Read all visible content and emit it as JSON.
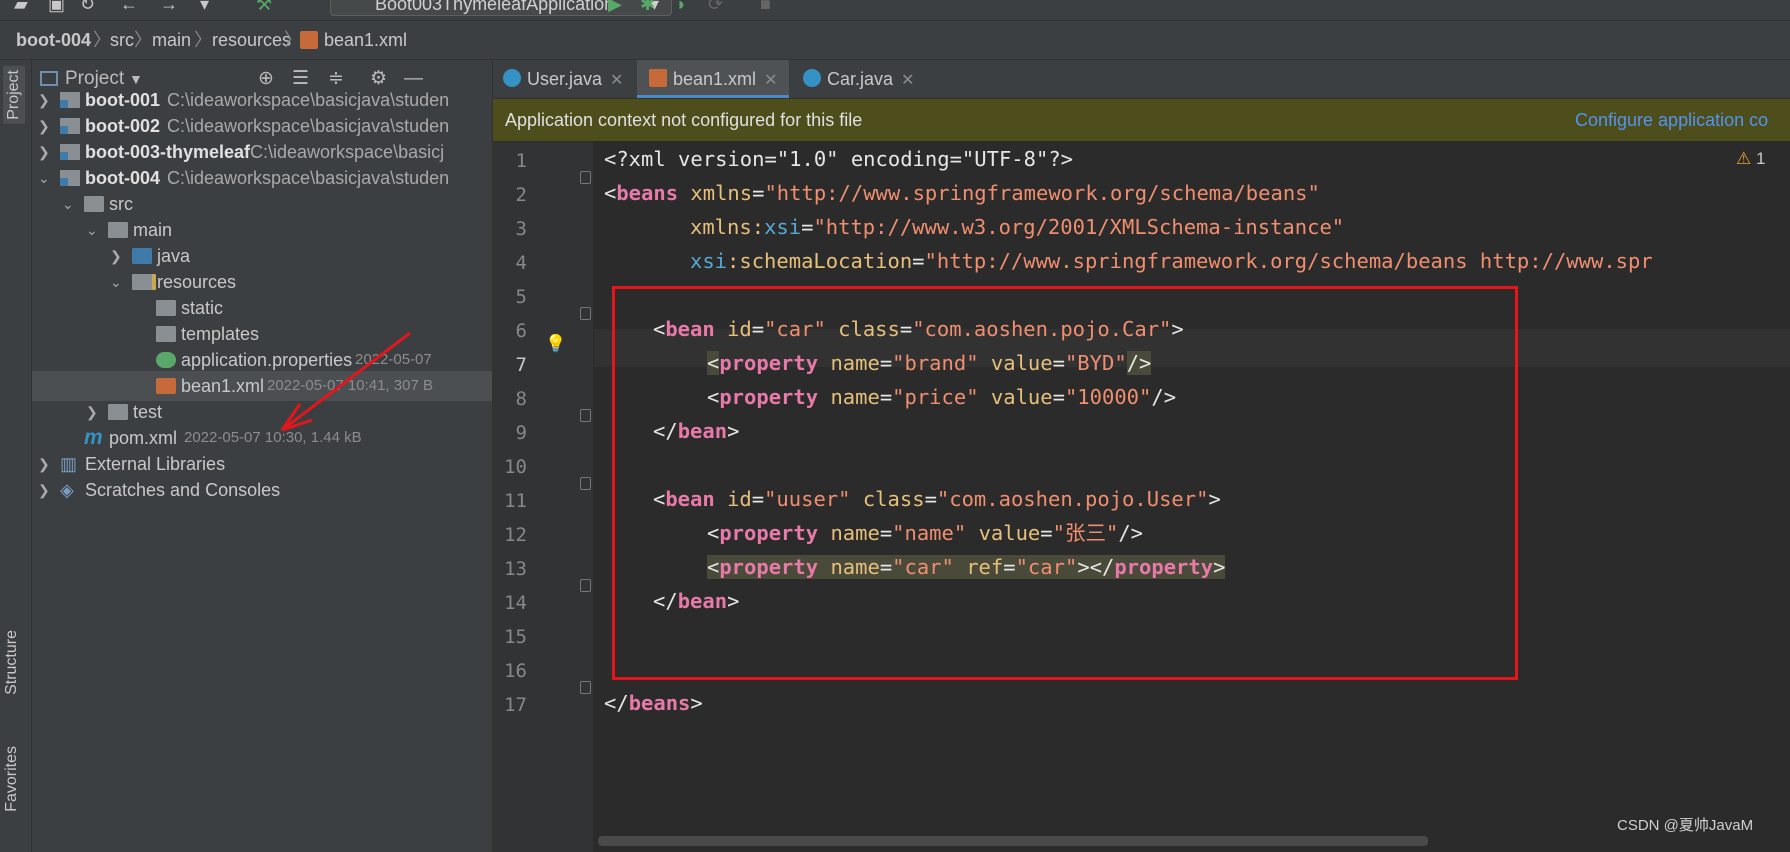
{
  "toolbar": {
    "run_config_label": "Boot003ThymeleafApplication"
  },
  "breadcrumb": {
    "items": [
      "boot-004",
      "src",
      "main",
      "resources",
      "bean1.xml"
    ]
  },
  "side_tabs": {
    "project": "Project",
    "structure": "Structure",
    "favorites": "Favorites"
  },
  "project_panel": {
    "title": "Project",
    "tree": [
      {
        "label": "boot-001",
        "path": "C:\\ideaworkspace\\basicjava\\studen"
      },
      {
        "label": "boot-002",
        "path": "C:\\ideaworkspace\\basicjava\\studen"
      },
      {
        "label": "boot-003-thymeleaf",
        "path": "C:\\ideaworkspace\\basicj"
      },
      {
        "label": "boot-004",
        "path": "C:\\ideaworkspace\\basicjava\\studen"
      },
      {
        "label": "src"
      },
      {
        "label": "main"
      },
      {
        "label": "java"
      },
      {
        "label": "resources"
      },
      {
        "label": "static"
      },
      {
        "label": "templates"
      },
      {
        "label": "application.properties",
        "meta": "2022-05-07"
      },
      {
        "label": "bean1.xml",
        "meta": "2022-05-07 10:41, 307 B"
      },
      {
        "label": "test"
      },
      {
        "label": "pom.xml",
        "meta": "2022-05-07 10:30, 1.44 kB"
      },
      {
        "label": "External Libraries"
      },
      {
        "label": "Scratches and Consoles"
      }
    ]
  },
  "editor": {
    "tabs": [
      {
        "label": "User.java"
      },
      {
        "label": "bean1.xml"
      },
      {
        "label": "Car.java"
      }
    ],
    "notification": {
      "message": "Application context not configured for this file",
      "action": "Configure application co"
    },
    "warning_count": "1",
    "line_numbers": [
      "1",
      "2",
      "3",
      "4",
      "5",
      "6",
      "7",
      "8",
      "9",
      "10",
      "11",
      "12",
      "13",
      "14",
      "15",
      "16",
      "17"
    ],
    "code": {
      "l1": "<?xml version=\"1.0\" encoding=\"UTF-8\"?>",
      "l2_tag": "beans",
      "l2_attr": "xmlns",
      "l2_val": "\"http://www.springframework.org/schema/beans\"",
      "l3_attr": "xmlns:",
      "l3_ns": "xsi",
      "l3_val": "\"http://www.w3.org/2001/XMLSchema-instance\"",
      "l4_ns": "xsi",
      "l4_attr": ":schemaLocation",
      "l4_val": "\"http://www.springframework.org/schema/beans http://www.spr",
      "bean_tag": "bean",
      "property_tag": "property",
      "l6_id": "\"car\"",
      "l6_class": "\"com.aoshen.pojo.Car\"",
      "l7_name": "\"brand\"",
      "l7_value": "\"BYD\"",
      "l8_name": "\"price\"",
      "l8_value": "\"10000\"",
      "l11_id": "\"uuser\"",
      "l11_class": "\"com.aoshen.pojo.User\"",
      "l12_name": "\"name\"",
      "l12_value": "\"张三\"",
      "l13_name": "\"car\"",
      "l13_ref": "\"car\"",
      "l17_tag": "beans",
      "attr_id": "id",
      "attr_class": "class",
      "attr_name": "name",
      "attr_value": "value",
      "attr_ref": "ref"
    }
  },
  "watermark": "CSDN @夏帅JavaM",
  "colors": {
    "annotation_red": "#e2161b",
    "tag_pink": "#e77aa8",
    "string_orange": "#f08f6f",
    "link_blue": "#5394ec"
  }
}
